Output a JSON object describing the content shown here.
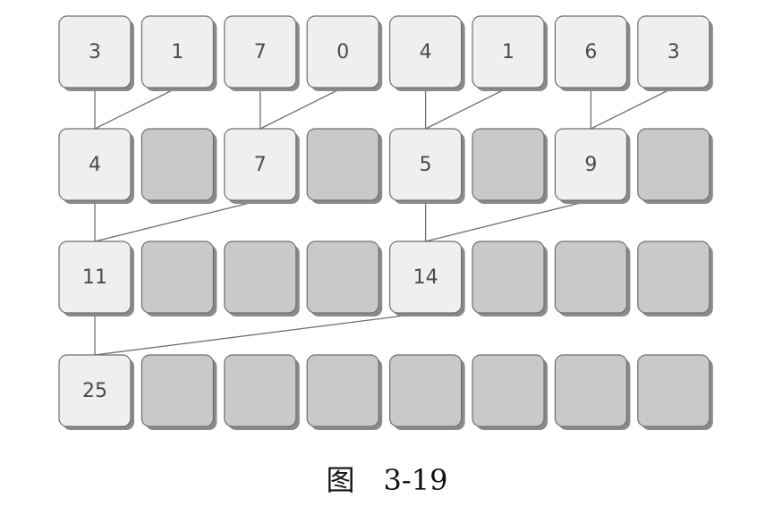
{
  "diagram": {
    "rows": [
      {
        "cells": [
          "3",
          "1",
          "7",
          "0",
          "4",
          "1",
          "6",
          "3"
        ]
      },
      {
        "cells": [
          "4",
          null,
          "7",
          null,
          "5",
          null,
          "9",
          null
        ]
      },
      {
        "cells": [
          "11",
          null,
          null,
          null,
          "14",
          null,
          null,
          null
        ]
      },
      {
        "cells": [
          "25",
          null,
          null,
          null,
          null,
          null,
          null,
          null
        ]
      }
    ],
    "connections": [
      {
        "from_row": 0,
        "from_col": 0,
        "to_col": 0
      },
      {
        "from_row": 0,
        "from_col": 1,
        "to_col": 0
      },
      {
        "from_row": 0,
        "from_col": 2,
        "to_col": 2
      },
      {
        "from_row": 0,
        "from_col": 3,
        "to_col": 2
      },
      {
        "from_row": 0,
        "from_col": 4,
        "to_col": 4
      },
      {
        "from_row": 0,
        "from_col": 5,
        "to_col": 4
      },
      {
        "from_row": 0,
        "from_col": 6,
        "to_col": 6
      },
      {
        "from_row": 0,
        "from_col": 7,
        "to_col": 6
      },
      {
        "from_row": 1,
        "from_col": 0,
        "to_col": 0
      },
      {
        "from_row": 1,
        "from_col": 2,
        "to_col": 0
      },
      {
        "from_row": 1,
        "from_col": 4,
        "to_col": 4
      },
      {
        "from_row": 1,
        "from_col": 6,
        "to_col": 4
      },
      {
        "from_row": 2,
        "from_col": 0,
        "to_col": 0
      },
      {
        "from_row": 2,
        "from_col": 4,
        "to_col": 0
      }
    ],
    "colors": {
      "filled_cell": "#efefef",
      "empty_cell": "#c9c9c9",
      "cell_shadow": "#8a8a8a",
      "border": "#6f6f6f",
      "connector": "#6f6f6f",
      "text": "#4a4a4a"
    }
  },
  "caption": "图　3-19"
}
